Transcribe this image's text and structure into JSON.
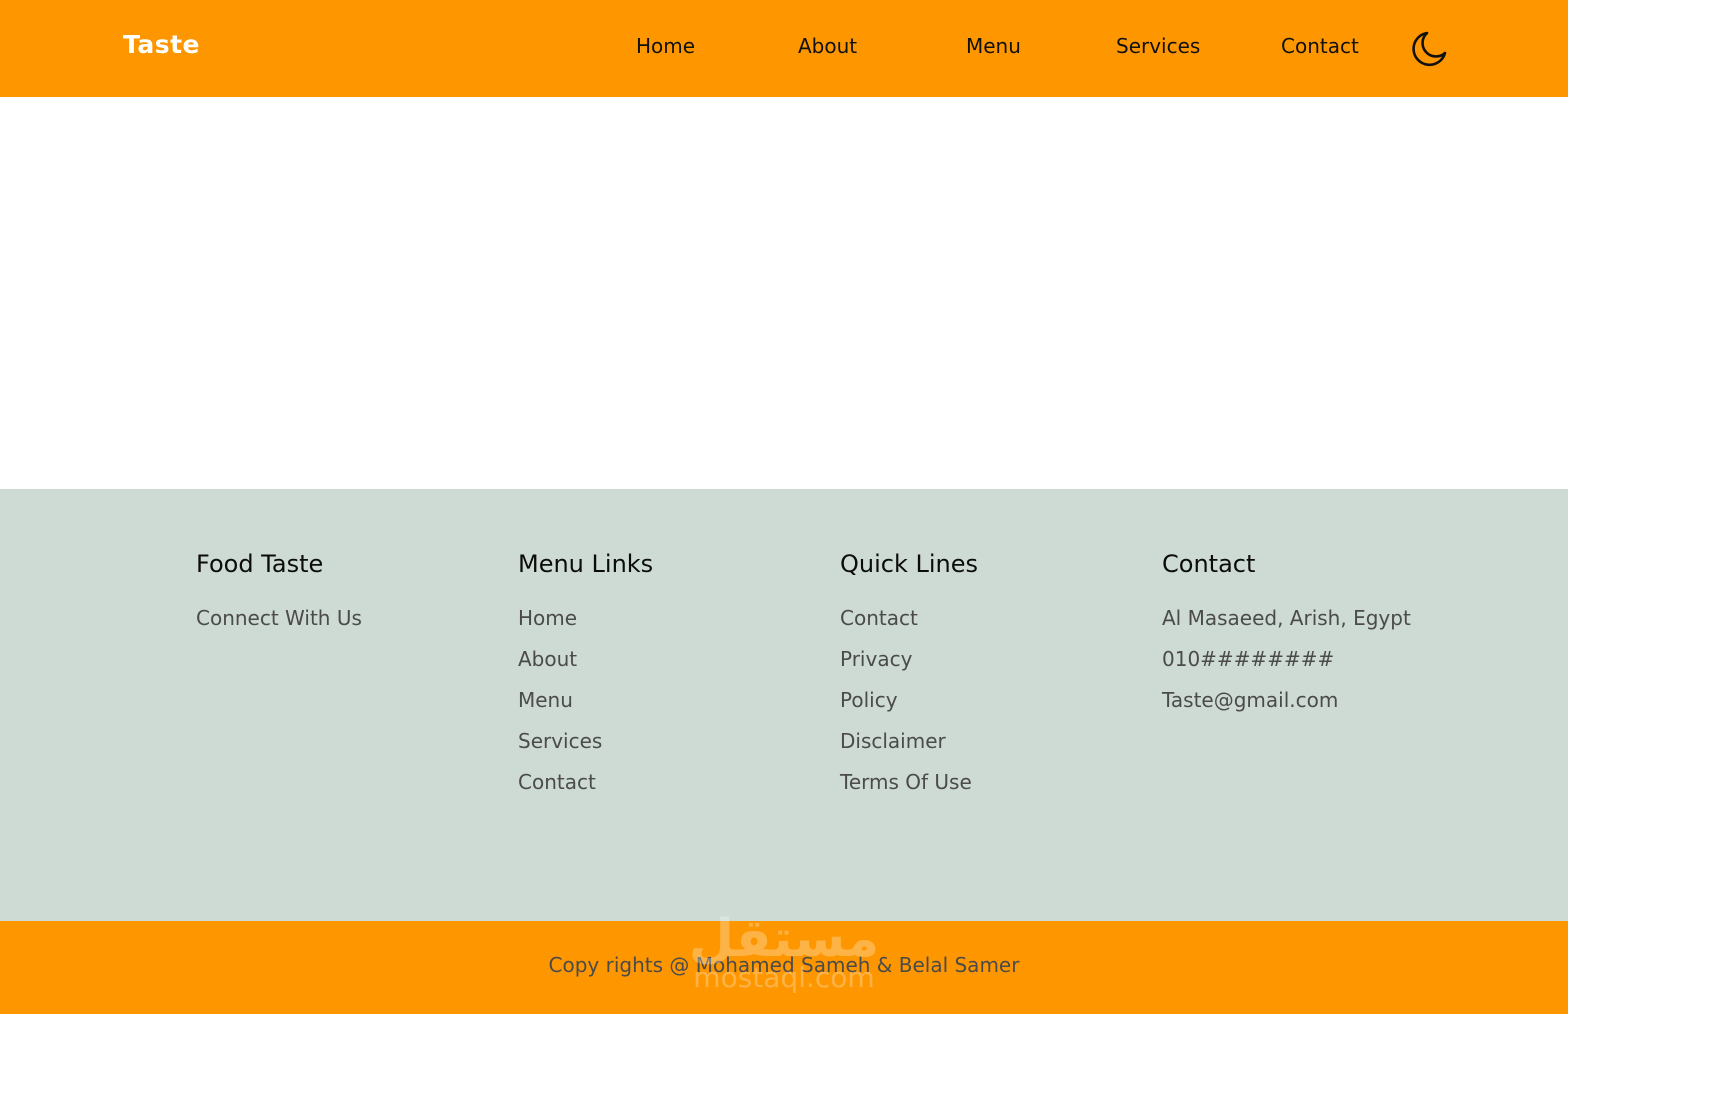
{
  "navbar": {
    "logo": "Taste",
    "links": [
      "Home",
      "About",
      "Menu",
      "Services",
      "Contact"
    ],
    "theme_toggle_icon": "moon-icon"
  },
  "footer": {
    "columns": [
      {
        "title": "Food Taste",
        "items": [
          "Connect With Us"
        ]
      },
      {
        "title": "Menu Links",
        "items": [
          "Home",
          "About",
          "Menu",
          "Services",
          "Contact"
        ]
      },
      {
        "title": "Quick Lines",
        "items": [
          "Contact",
          "Privacy",
          "Policy",
          "Disclaimer",
          "Terms Of Use"
        ]
      },
      {
        "title": "Contact",
        "items": [
          "Al Masaeed, Arish, Egypt",
          "010########",
          "Taste@gmail.com"
        ]
      }
    ]
  },
  "bottom_bar": {
    "copyright": "Copy rights @ Mohamed Sameh & Belal Samer"
  },
  "watermark": {
    "line1": "مستقل",
    "line2": "mostaql.com"
  },
  "colors": {
    "primary": "#fe9600",
    "footer_bg": "#cedbd4",
    "text_dark": "#111111",
    "text_muted": "#4b4b4b"
  }
}
